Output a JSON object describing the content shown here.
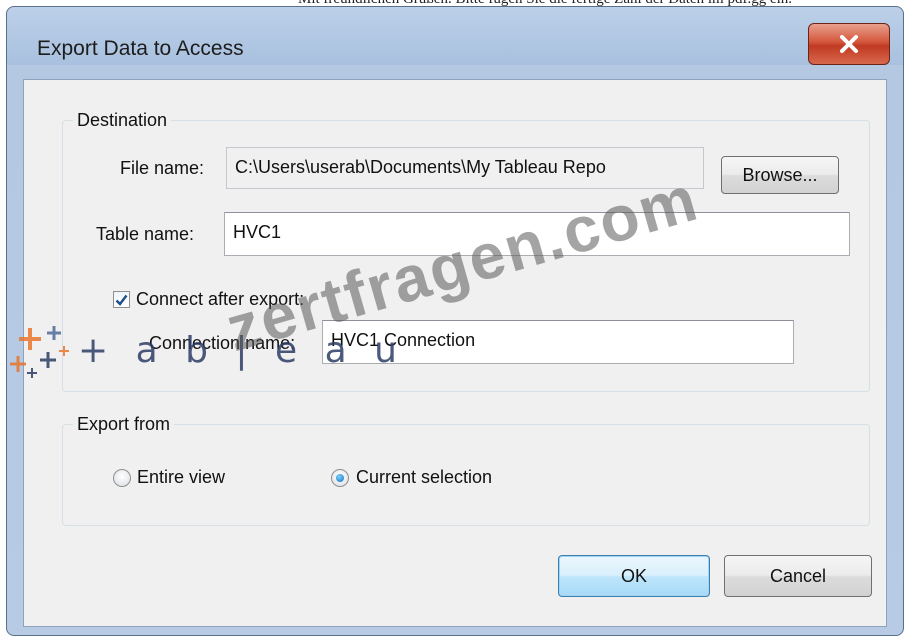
{
  "caption": "Mit freundlichen Grüßen. Bitte fügen Sie die fertige Zahl der Daten im pdf.gg ein.",
  "window": {
    "title": "Export Data to Access"
  },
  "destination": {
    "group_title": "Destination",
    "file_name_label": "File name:",
    "file_name_value": "C:\\Users\\userab\\Documents\\My Tableau Repo",
    "browse_label": "Browse...",
    "table_name_label": "Table name:",
    "table_name_value": "HVC1",
    "connect_checkbox_label": "Connect after export:",
    "connect_checked": true,
    "connection_name_label": "Connection name:",
    "connection_name_value": "HVC1 Connection"
  },
  "export_from": {
    "group_title": "Export from",
    "options": [
      {
        "label": "Entire view",
        "selected": false
      },
      {
        "label": "Current selection",
        "selected": true
      }
    ]
  },
  "buttons": {
    "ok": "OK",
    "cancel": "Cancel"
  },
  "overlays": {
    "logo_text": "+ a b | e a u",
    "watermark": "zertfragen.com"
  },
  "colors": {
    "frame": "#b7cbe4",
    "client": "#f0f0f0",
    "close_button": "#c94a32",
    "default_button_border": "#3c7fb1",
    "checkmark": "#1f4f8a",
    "logo_orange": "#e8762b",
    "logo_blue": "#2c3d66"
  }
}
